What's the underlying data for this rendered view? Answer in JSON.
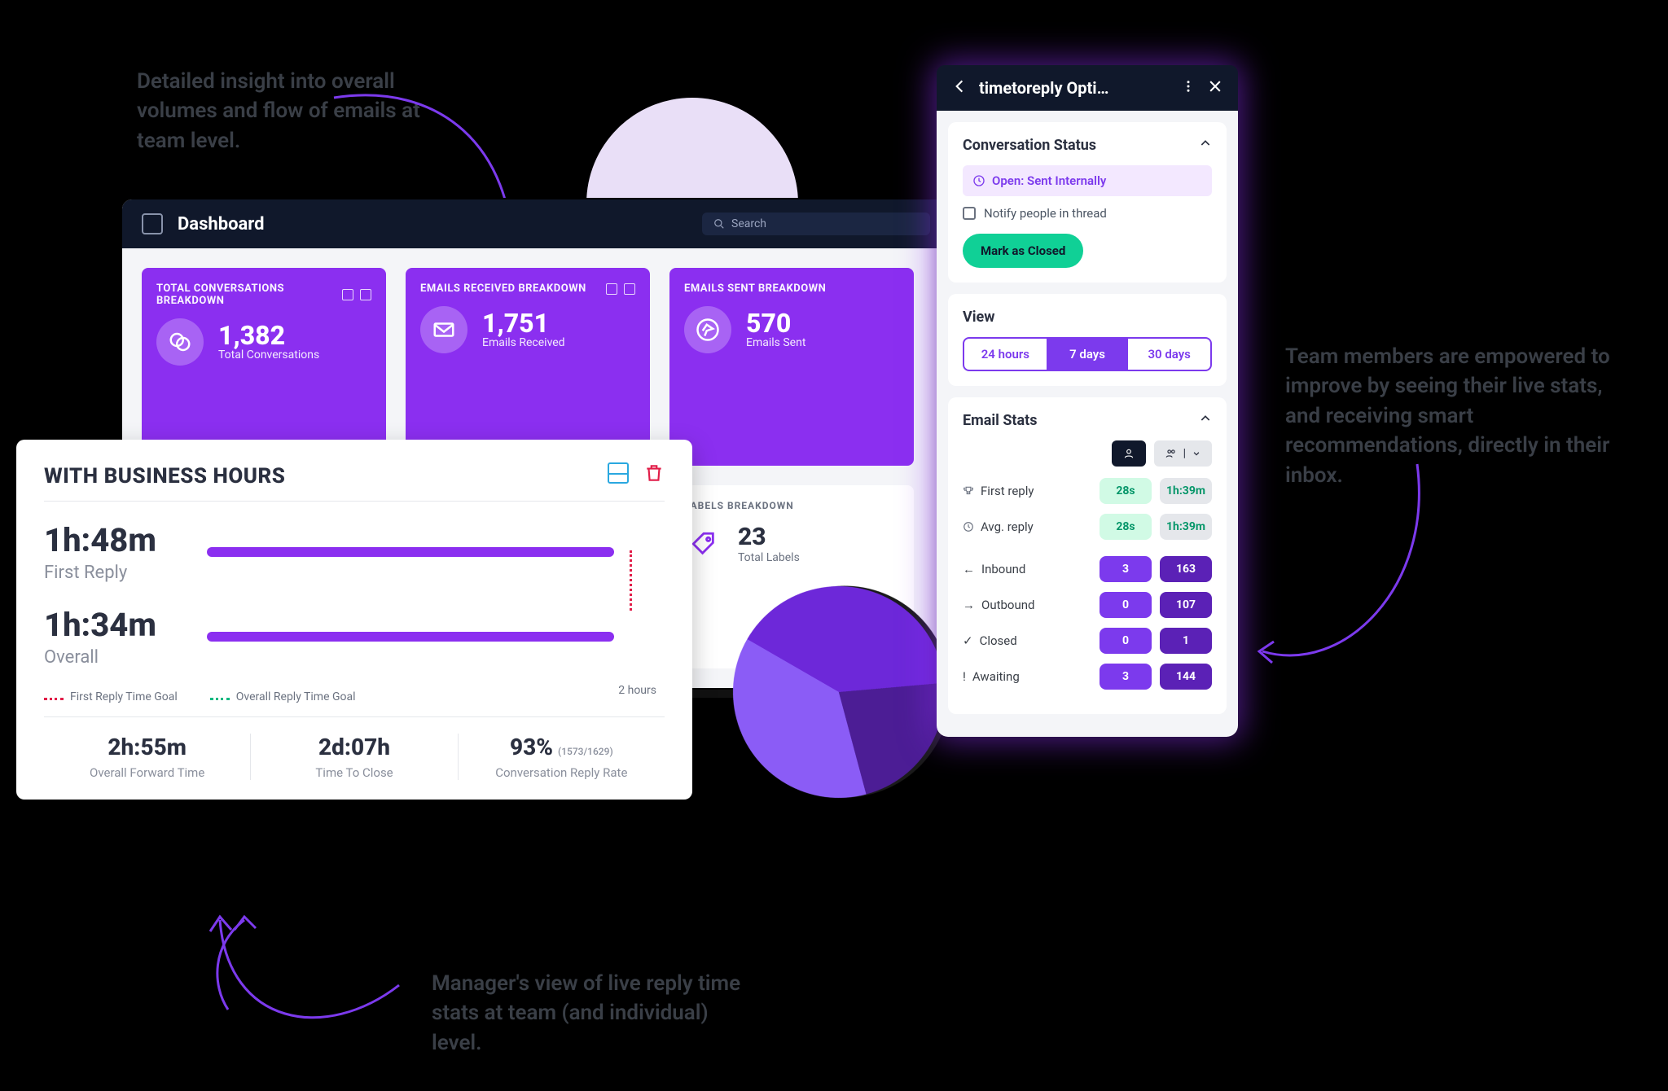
{
  "annotations": {
    "top_left": "Detailed insight into overall volumes and flow of emails at team level.",
    "right": "Team members are empowered to improve by seeing their live stats, and receiving smart recommendations, directly in their inbox.",
    "bottom": "Manager's view of live reply time stats at team (and individual) level."
  },
  "dashboard": {
    "title": "Dashboard",
    "search_placeholder": "Search",
    "cards": {
      "conversations": {
        "title": "TOTAL CONVERSATIONS BREAKDOWN",
        "value": "1,382",
        "sub": "Total Conversations"
      },
      "received": {
        "title": "EMAILS RECEIVED BREAKDOWN",
        "value": "1,751",
        "sub": "Emails Received"
      },
      "sent": {
        "title": "EMAILS SENT BREAKDOWN",
        "value": "570",
        "sub": "Emails Sent"
      }
    },
    "labels": {
      "title": "LABELS BREAKDOWN",
      "value": "23",
      "sub": "Total Labels"
    }
  },
  "business_hours": {
    "title": "WITH BUSINESS HOURS",
    "first_reply": {
      "value": "1h:48m",
      "label": "First Reply"
    },
    "overall": {
      "value": "1h:34m",
      "label": "Overall"
    },
    "goal_marker": "2 hours",
    "legend_first": "First Reply Time Goal",
    "legend_overall": "Overall Reply Time Goal",
    "metrics": {
      "forward": {
        "value": "2h:55m",
        "label": "Overall Forward Time"
      },
      "close": {
        "value": "2d:07h",
        "label": "Time To Close"
      },
      "replyrate": {
        "value": "93%",
        "tiny": "(1573/1629)",
        "label": "Conversation Reply Rate"
      }
    }
  },
  "phone": {
    "title": "timetoreply Opti…",
    "conversation_status": {
      "heading": "Conversation Status",
      "status": "Open: Sent Internally",
      "notify": "Notify people in thread",
      "close_btn": "Mark as Closed"
    },
    "view": {
      "heading": "View",
      "options": [
        "24 hours",
        "7 days",
        "30 days"
      ],
      "active_index": 1
    },
    "email_stats": {
      "heading": "Email Stats",
      "rows": {
        "first_reply": {
          "label": "First reply",
          "a": "28s",
          "b": "1h:39m"
        },
        "avg_reply": {
          "label": "Avg. reply",
          "a": "28s",
          "b": "1h:39m"
        },
        "inbound": {
          "label": "Inbound",
          "a": "3",
          "b": "163"
        },
        "outbound": {
          "label": "Outbound",
          "a": "0",
          "b": "107"
        },
        "closed": {
          "label": "Closed",
          "a": "0",
          "b": "1"
        },
        "awaiting": {
          "label": "Awaiting",
          "a": "3",
          "b": "144"
        }
      }
    }
  }
}
